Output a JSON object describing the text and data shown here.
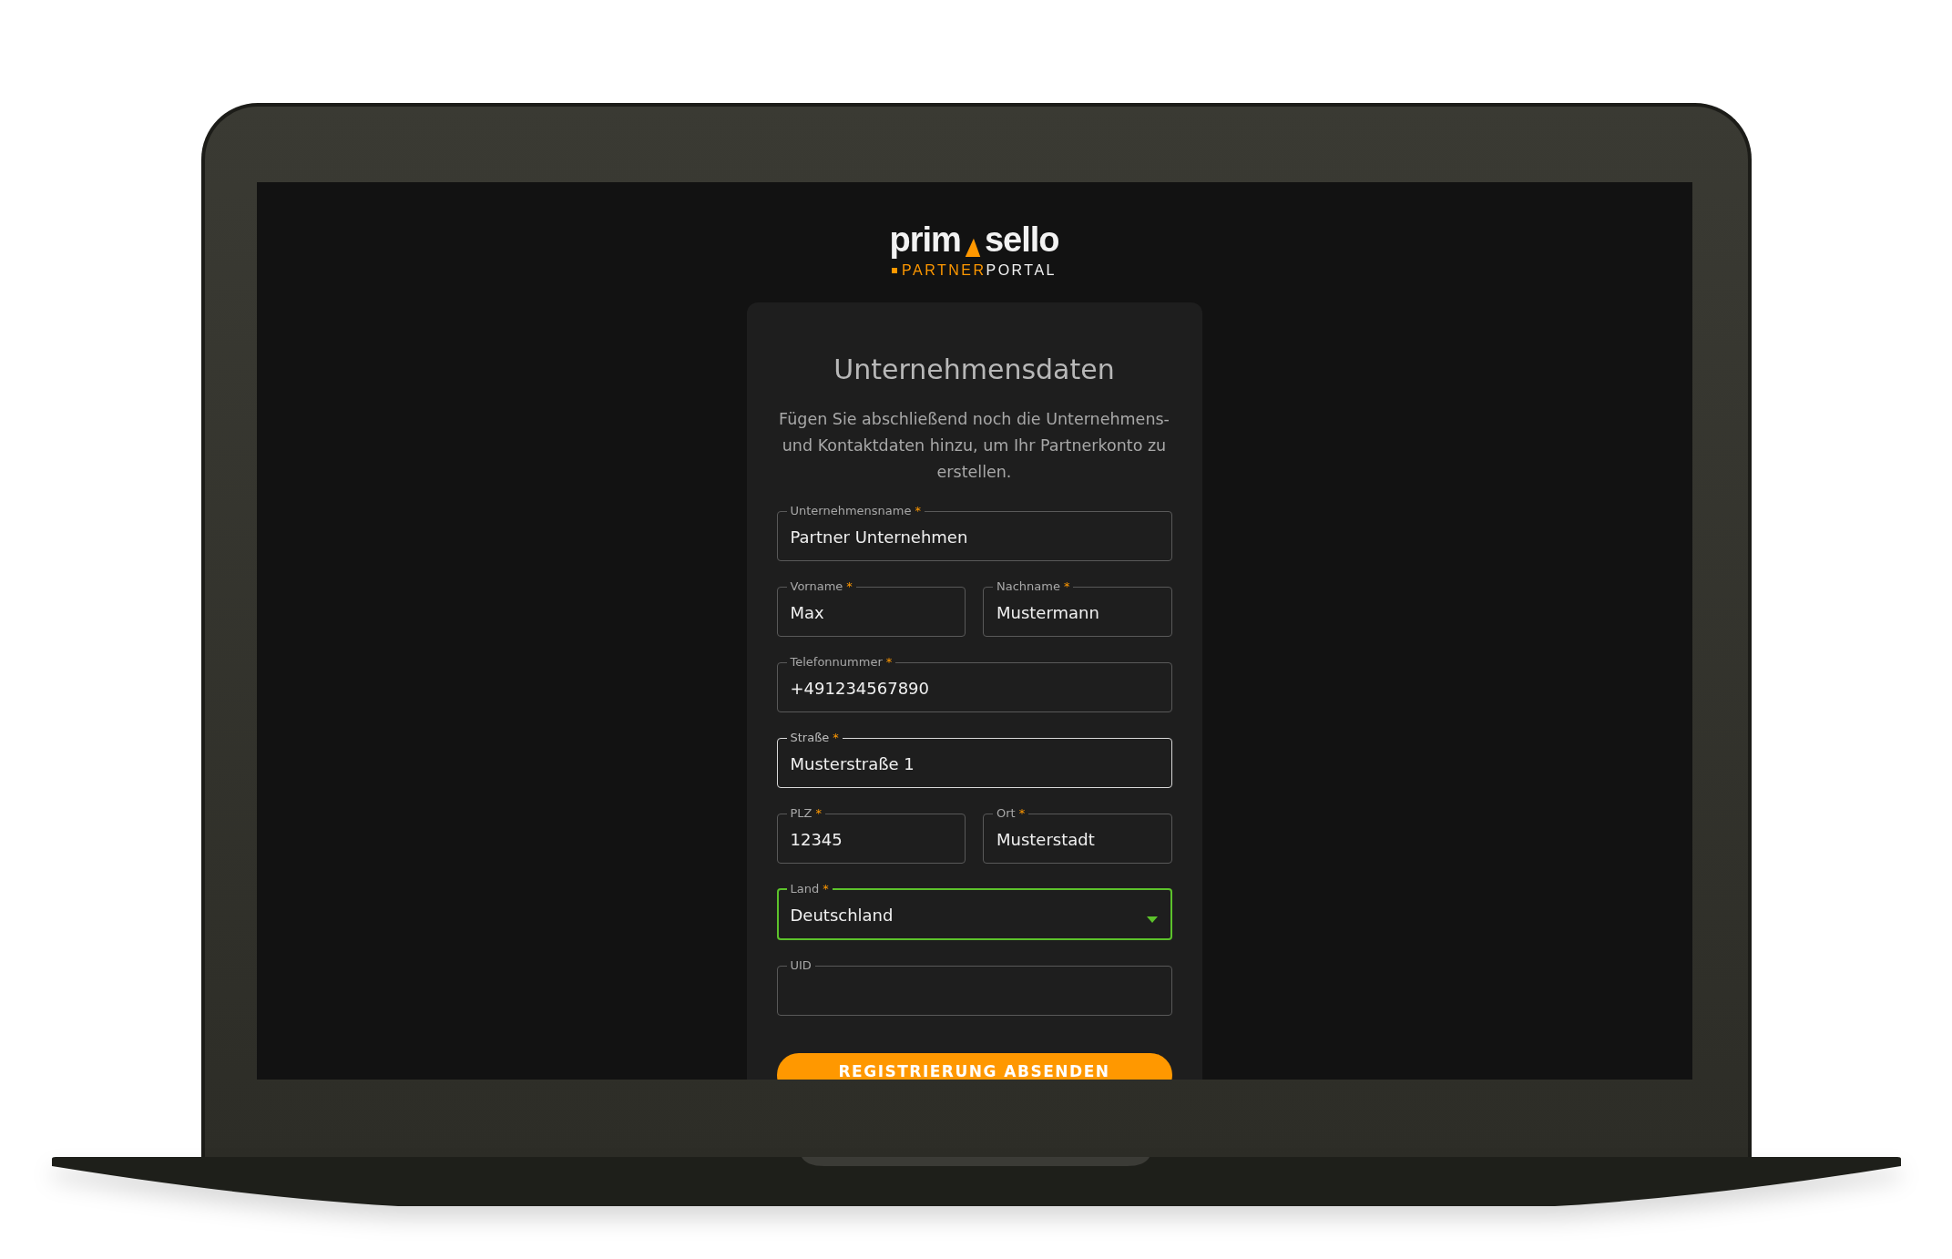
{
  "logo": {
    "word_start": "prim",
    "word_end": "sello",
    "sub_accent": "PARTNER",
    "sub_rest": "PORTAL"
  },
  "card": {
    "title": "Unternehmensdaten",
    "description": "Fügen Sie abschließend noch die Unternehmens- und Kontaktdaten hinzu, um Ihr Partnerkonto zu erstellen."
  },
  "rows": [
    {
      "fields": [
        {
          "kind": "text",
          "label": "Unternehmensname",
          "required_mark": "*",
          "value": "Partner Unternehmen",
          "hovered": false,
          "focused": false
        }
      ]
    },
    {
      "fields": [
        {
          "kind": "text",
          "label": "Vorname",
          "required_mark": "*",
          "value": "Max",
          "hovered": false,
          "focused": false
        },
        {
          "kind": "text",
          "label": "Nachname",
          "required_mark": "*",
          "value": "Mustermann",
          "hovered": false,
          "focused": false
        }
      ]
    },
    {
      "fields": [
        {
          "kind": "text",
          "label": "Telefonnummer",
          "required_mark": "*",
          "value": "+491234567890",
          "hovered": false,
          "focused": false
        }
      ]
    },
    {
      "fields": [
        {
          "kind": "text",
          "label": "Straße",
          "required_mark": "*",
          "value": "Musterstraße 1",
          "hovered": true,
          "focused": false
        }
      ]
    },
    {
      "fields": [
        {
          "kind": "text",
          "label": "PLZ",
          "required_mark": "*",
          "value": "12345",
          "hovered": false,
          "focused": false
        },
        {
          "kind": "text",
          "label": "Ort",
          "required_mark": "*",
          "value": "Musterstadt",
          "hovered": false,
          "focused": false
        }
      ]
    },
    {
      "fields": [
        {
          "kind": "select",
          "label": "Land",
          "required_mark": "*",
          "value": "Deutschland",
          "hovered": false,
          "focused": true
        }
      ]
    },
    {
      "fields": [
        {
          "kind": "text",
          "label": "UID",
          "hovered": false,
          "focused": false
        }
      ]
    }
  ],
  "submit": {
    "label": "REGISTRIERUNG ABSENDEN"
  }
}
